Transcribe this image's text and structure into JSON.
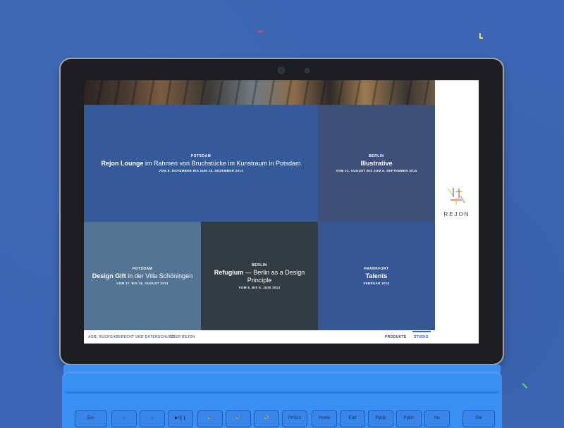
{
  "tiles": {
    "lounge": {
      "city": "POTSDAM",
      "title_bold": "Rejon Lounge",
      "title_rest": " im Rahmen von Bruchstücke im Kunstraum in Potsdam",
      "dates": "VOM 8. NOVEMBER BIS ZUM 15. DEZEMBER 2013"
    },
    "illustrative": {
      "city": "BERLIN",
      "title_bold": "Illustrative",
      "title_rest": "",
      "dates": "VOM 21. AUGUST BIS ZUM 8. SEPTEMBER 2013"
    },
    "gift": {
      "city": "POTSDAM",
      "title_bold": "Design Gift",
      "title_rest": " in der Villa Schöningen",
      "dates": "VOM 17. BIS 18. AUGUST 2013"
    },
    "refugium": {
      "city": "BERLIN",
      "title_bold": "Refugium",
      "title_rest": " — Berlin as a Design Principle",
      "dates": "VOM 5. BIS 9. JUNI 2013"
    },
    "talents": {
      "city": "FRANKFURT",
      "title_bold": "Talents",
      "title_rest": "",
      "dates": "FEBRUAR 2013"
    }
  },
  "sidebar": {
    "logo_text": "REJON",
    "logo_icon": "rejon-logo-icon"
  },
  "footer": {
    "agb": "AGB, RÜCKGABERECHT UND DATENSCHUTZ",
    "uber": "ÜBER REJON",
    "produkte": "PRODUKTE",
    "studio": "STUDIO"
  },
  "keyboard": {
    "keys": [
      "Esc",
      "☼",
      "☼",
      "▶/❙❙",
      "🔈",
      "🔉",
      "🔊",
      "PrtScn",
      "Home",
      "End",
      "PgUp",
      "PgDn",
      "Ins",
      "Del"
    ]
  },
  "colors": {
    "background": "#3c66b3",
    "accent": "#3f67b3",
    "tile_lounge": "#345a99",
    "tile_illustrative": "#3e4f7a",
    "tile_gift": "#537494",
    "tile_refugium": "#323c45",
    "tile_talents": "#365796"
  }
}
